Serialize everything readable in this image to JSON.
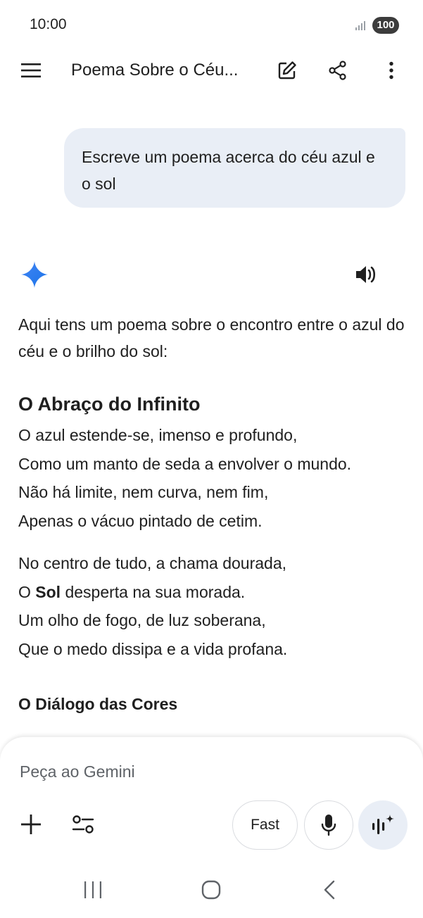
{
  "status_bar": {
    "time": "10:00",
    "battery": "100",
    "icons": [
      "signal-icon",
      "battery-icon"
    ]
  },
  "app_bar": {
    "title": "Poema Sobre o Céu...",
    "icons": [
      "menu-icon",
      "edit-icon",
      "share-icon",
      "more-vert-icon"
    ]
  },
  "conversation": {
    "user_message": "Escreve um poema acerca do céu azul e o sol",
    "response": {
      "intro": "Aqui tens um poema sobre o encontro entre o azul do céu e o brilho do sol:",
      "poem_title": "O Abraço do Infinito",
      "stanza1": {
        "line1": "O azul estende-se, imenso e profundo,",
        "line2": "Como um manto de seda a envolver o mundo.",
        "line3": "Não há limite, nem curva, nem fim,",
        "line4": "Apenas o vácuo pintado de cetim."
      },
      "stanza2": {
        "line1": "No centro de tudo, a chama dourada,",
        "line2_prefix": "O ",
        "line2_bold": "Sol",
        "line2_suffix": " desperta na sua morada.",
        "line3": "Um olho de fogo, de luz soberana,",
        "line4": "Que o medo dissipa e a vida profana."
      },
      "subheading": "O Diálogo das Cores"
    }
  },
  "composer": {
    "placeholder": "Peça ao Gemini",
    "model_label": "Fast",
    "icons": [
      "plus-icon",
      "tools-icon",
      "mic-icon",
      "live-icon"
    ]
  },
  "colors": {
    "bubble": "#e9eef6",
    "gemini_blue": "#4285f4",
    "text": "#1f1f1f",
    "muted": "#5f6368"
  }
}
